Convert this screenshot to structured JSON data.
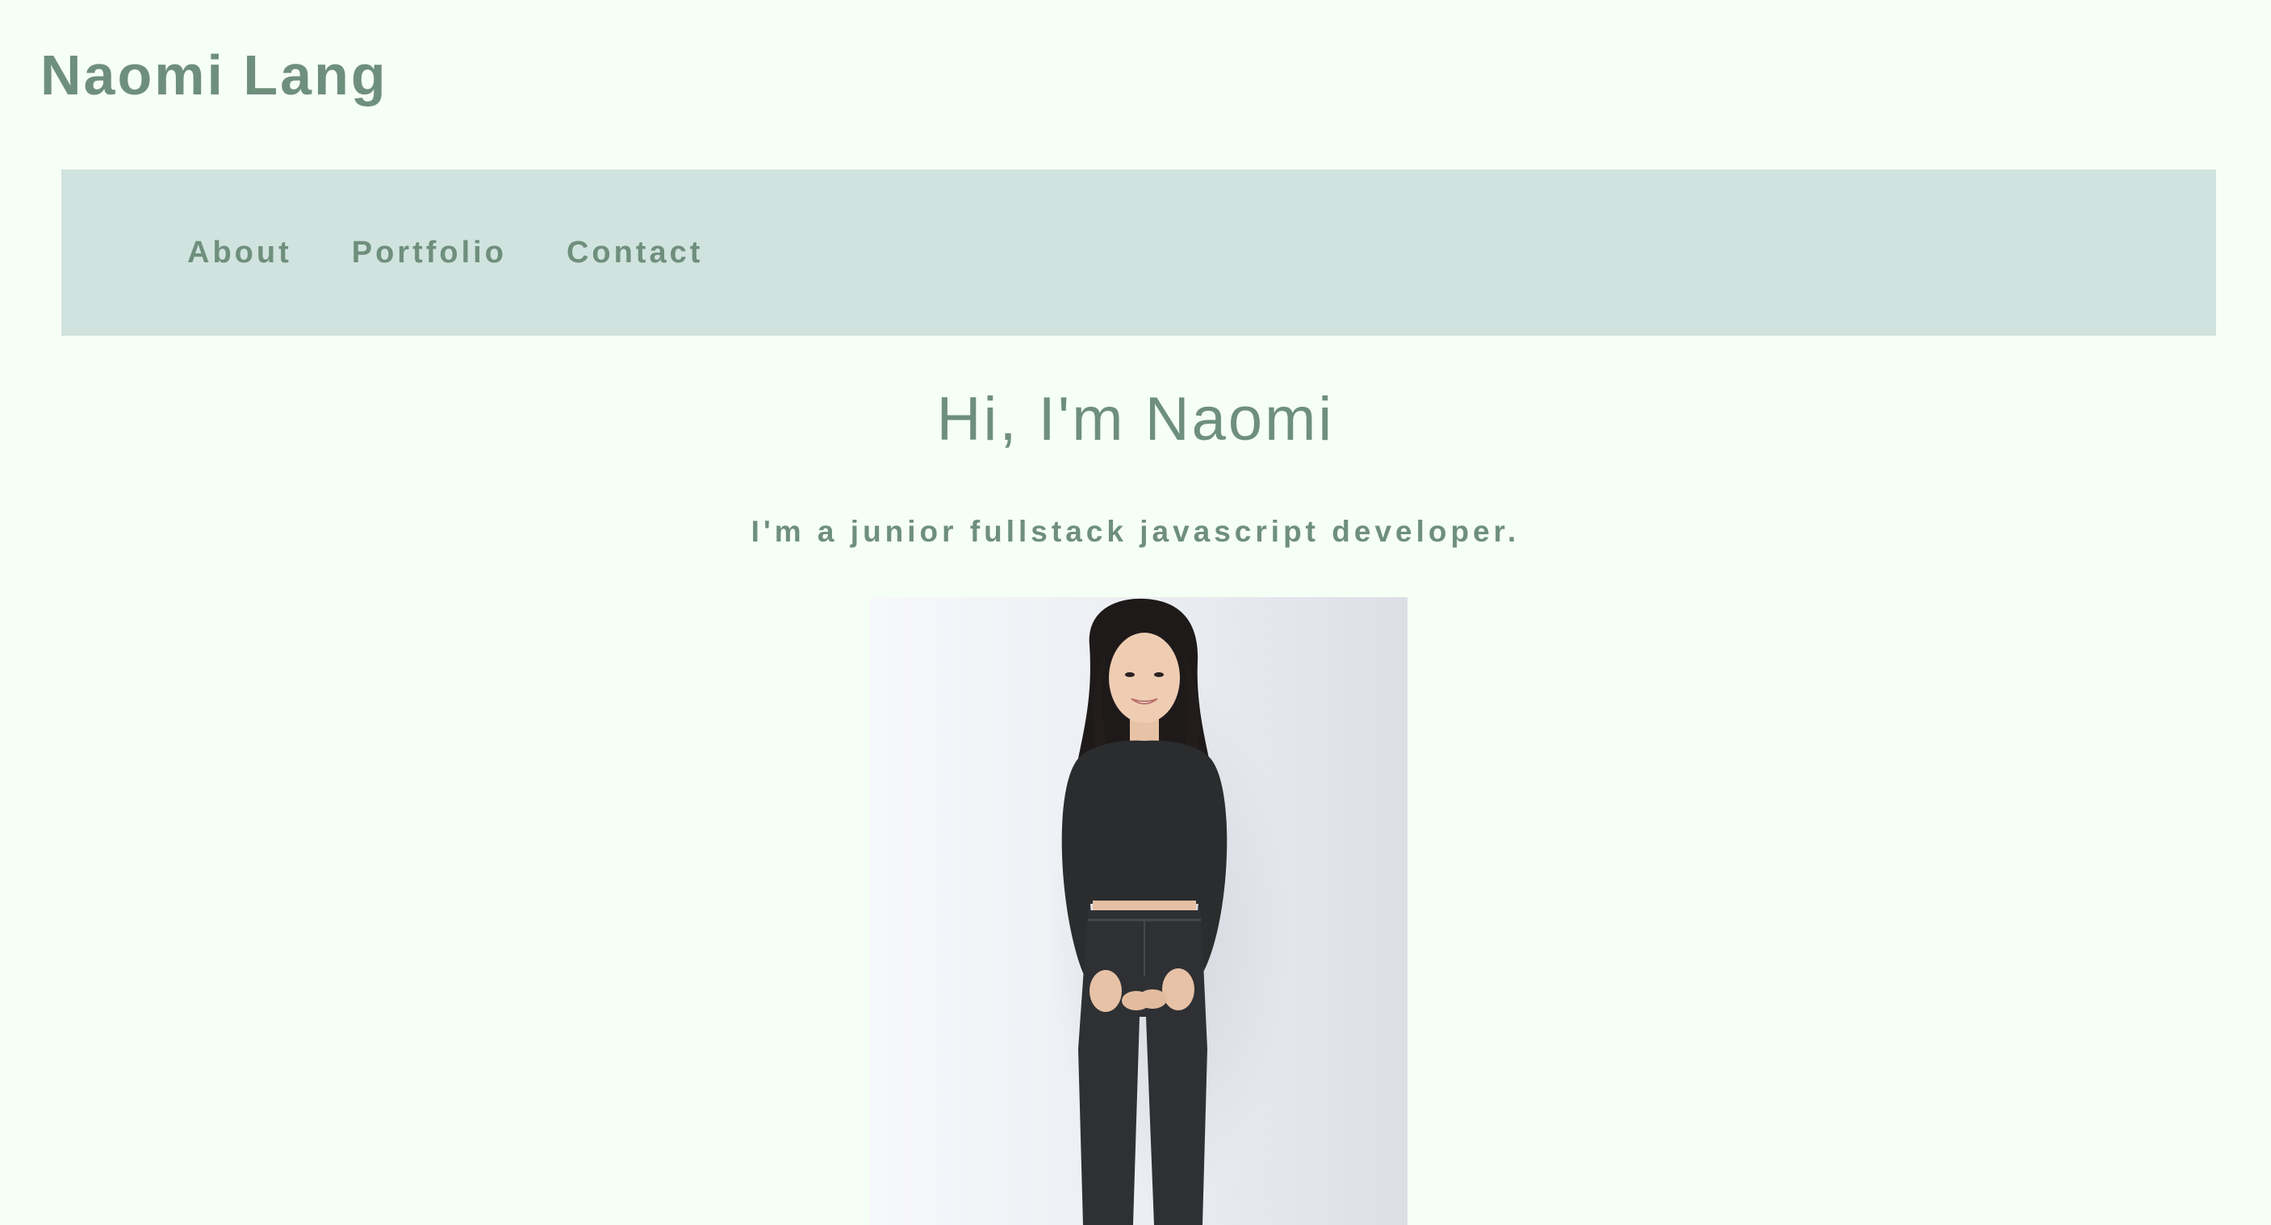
{
  "header": {
    "site_title": "Naomi Lang"
  },
  "nav": {
    "items": [
      {
        "label": "About"
      },
      {
        "label": "Portfolio"
      },
      {
        "label": "Contact"
      }
    ]
  },
  "hero": {
    "heading": "Hi, I'm Naomi",
    "subtitle": "I'm a junior fullstack javascript developer."
  },
  "colors": {
    "background": "#f6fff5",
    "nav_background": "#d0e3de",
    "text": "#6f8f7d"
  }
}
